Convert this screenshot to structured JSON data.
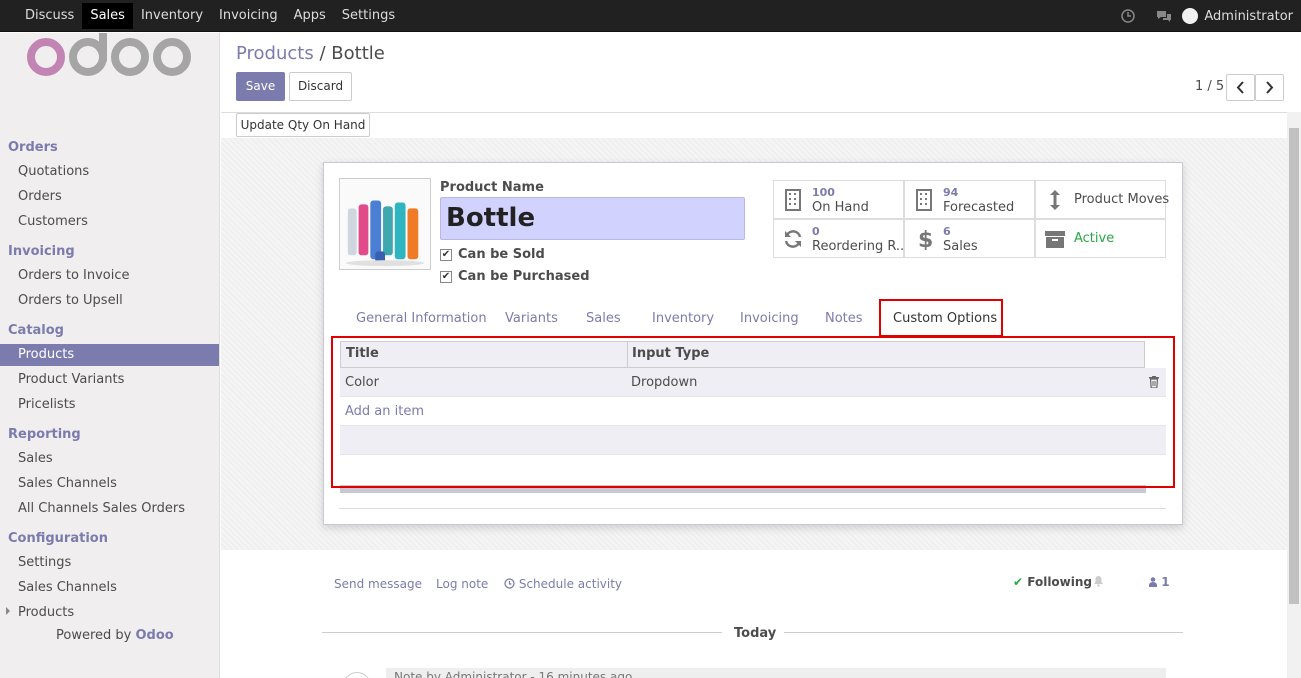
{
  "topbar": {
    "menu": [
      "Discuss",
      "Sales",
      "Inventory",
      "Invoicing",
      "Apps",
      "Settings"
    ],
    "active": "Sales",
    "user": "Administrator"
  },
  "sidebar": {
    "logo": "odoo",
    "sections": [
      {
        "title": "Orders",
        "items": [
          "Quotations",
          "Orders",
          "Customers"
        ]
      },
      {
        "title": "Invoicing",
        "items": [
          "Orders to Invoice",
          "Orders to Upsell"
        ]
      },
      {
        "title": "Catalog",
        "items": [
          "Products",
          "Product Variants",
          "Pricelists"
        ]
      },
      {
        "title": "Reporting",
        "items": [
          "Sales",
          "Sales Channels",
          "All Channels Sales Orders"
        ]
      },
      {
        "title": "Configuration",
        "items": [
          "Settings",
          "Sales Channels",
          "Products"
        ]
      }
    ],
    "active_item": "Products",
    "powered_prefix": "Powered by",
    "powered_brand": "Odoo"
  },
  "breadcrumb": {
    "parent": "Products",
    "separator": "/",
    "current": "Bottle"
  },
  "buttons": {
    "save": "Save",
    "discard": "Discard",
    "update_qty": "Update Qty On Hand"
  },
  "pager": {
    "value": "1 / 5"
  },
  "product": {
    "name_label": "Product Name",
    "name": "Bottle",
    "can_be_sold": "Can be Sold",
    "can_be_purchased": "Can be Purchased"
  },
  "smart_buttons": {
    "on_hand": {
      "value": "100",
      "label": "On Hand"
    },
    "forecasted": {
      "value": "94",
      "label": "Forecasted"
    },
    "moves": {
      "label": "Product Moves"
    },
    "reordering": {
      "value": "0",
      "label": "Reordering R..."
    },
    "sales": {
      "value": "6",
      "label": "Sales"
    },
    "active": {
      "label": "Active"
    }
  },
  "tabs": [
    "General Information",
    "Variants",
    "Sales",
    "Inventory",
    "Invoicing",
    "Notes",
    "Custom Options"
  ],
  "active_tab": "Custom Options",
  "table": {
    "columns": [
      "Title",
      "Input Type"
    ],
    "rows": [
      [
        "Color",
        "Dropdown"
      ]
    ],
    "add_item": "Add an item"
  },
  "chatter": {
    "send_message": "Send message",
    "log_note": "Log note",
    "schedule_activity": "Schedule activity",
    "following": "Following",
    "followers_count": "1",
    "today": "Today",
    "message_header": "Note by Administrator - 16 minutes ago"
  },
  "colors": {
    "brand": "#7c7bad",
    "highlight": "#e00000",
    "active_green": "#28a745"
  }
}
